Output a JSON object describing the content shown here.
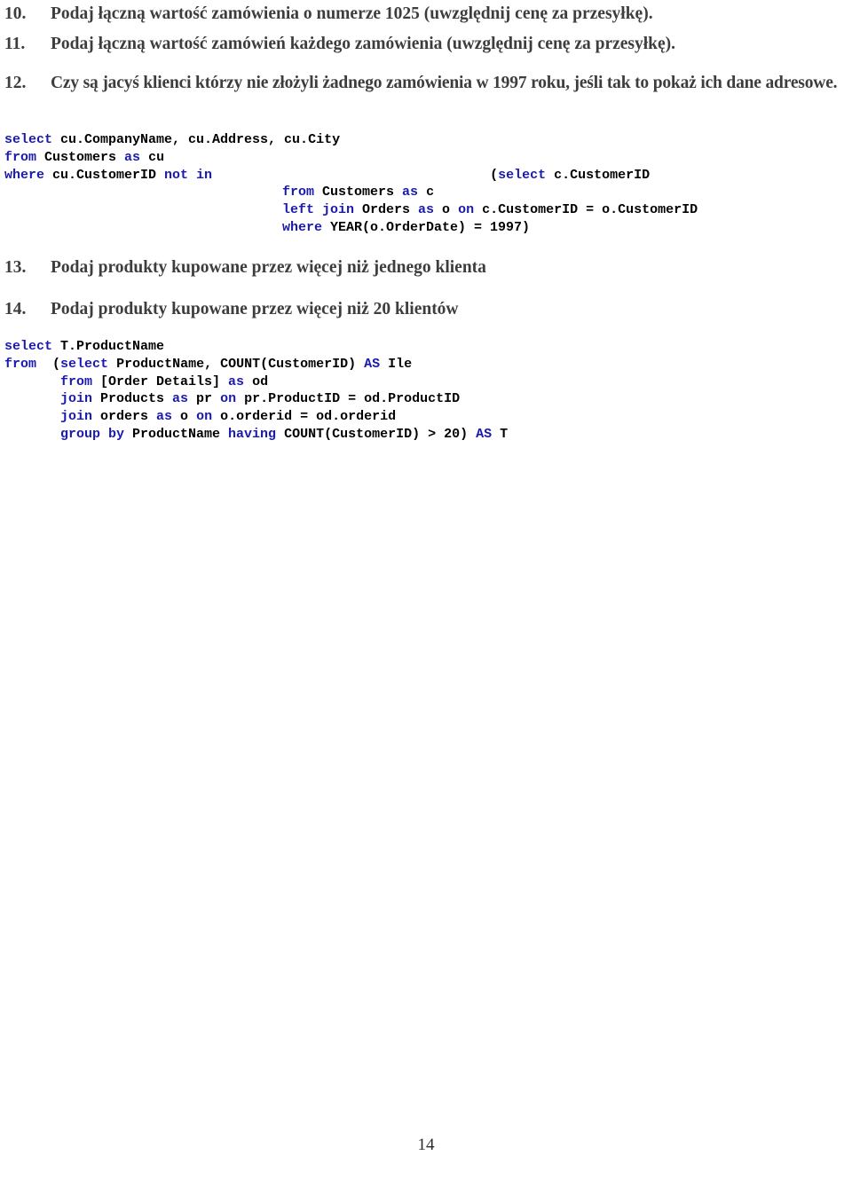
{
  "document": {
    "page_number": "14",
    "language": "pl",
    "colors": {
      "heading_text": "#3d3d3d",
      "code_keyword": "#1a1aae",
      "code_identifier": "#000000",
      "background": "#ffffff"
    }
  },
  "items": [
    {
      "number": "10.",
      "text": "Podaj łączną wartość zamówienia o numerze 1025 (uwzględnij cenę za przesyłkę)."
    },
    {
      "number": "11.",
      "text": "Podaj łączną wartość zamówień każdego zamówienia (uwzględnij cenę za przesyłkę)."
    },
    {
      "number": "12.",
      "text": "Czy są jacyś klienci którzy nie złożyli żadnego zamówienia w 1997 roku, jeśli tak to pokaż ich dane adresowe."
    },
    {
      "number": "13.",
      "text": "Podaj produkty kupowane przez więcej niż jednego klienta"
    },
    {
      "number": "14.",
      "text": "Podaj produkty kupowane przez więcej niż 20 klientów"
    }
  ],
  "code_blocks": [
    {
      "id": "query-12",
      "lines": [
        [
          {
            "t": "select",
            "c": "kw"
          },
          {
            "t": " cu.CompanyName, cu.Address, cu.City",
            "c": "ident"
          }
        ],
        [
          {
            "t": "from",
            "c": "kw"
          },
          {
            "t": " Customers ",
            "c": "ident"
          },
          {
            "t": "as",
            "c": "kw"
          },
          {
            "t": " cu",
            "c": "ident"
          }
        ],
        [
          {
            "t": "where",
            "c": "kw"
          },
          {
            "t": " cu.CustomerID ",
            "c": "ident"
          },
          {
            "t": "not in",
            "c": "kw"
          },
          {
            "t": "",
            "c": "indent-sub1"
          },
          {
            "t": "(",
            "c": "ident"
          },
          {
            "t": "select",
            "c": "kw"
          },
          {
            "t": " c.CustomerID",
            "c": "ident"
          }
        ],
        [
          {
            "t": "",
            "c": "indent-sub1"
          },
          {
            "t": "from",
            "c": "kw"
          },
          {
            "t": " Customers ",
            "c": "ident"
          },
          {
            "t": "as",
            "c": "kw"
          },
          {
            "t": " c",
            "c": "ident"
          }
        ],
        [
          {
            "t": "",
            "c": "indent-sub1"
          },
          {
            "t": "left join",
            "c": "kw"
          },
          {
            "t": " Orders ",
            "c": "ident"
          },
          {
            "t": "as",
            "c": "kw"
          },
          {
            "t": " o ",
            "c": "ident"
          },
          {
            "t": "on",
            "c": "kw"
          },
          {
            "t": " c.CustomerID = o.CustomerID",
            "c": "ident"
          }
        ],
        [
          {
            "t": "",
            "c": "indent-sub1"
          },
          {
            "t": "where",
            "c": "kw"
          },
          {
            "t": " YEAR(o.OrderDate) = 1997)",
            "c": "ident"
          }
        ]
      ]
    },
    {
      "id": "query-14",
      "lines": [
        [
          {
            "t": "select",
            "c": "kw"
          },
          {
            "t": " T.ProductName",
            "c": "ident"
          }
        ],
        [
          {
            "t": "from",
            "c": "kw"
          },
          {
            "t": "  ",
            "c": "ident"
          },
          {
            "t": "(",
            "c": "ident"
          },
          {
            "t": "select",
            "c": "kw"
          },
          {
            "t": " ProductName, COUNT(CustomerID) ",
            "c": "ident"
          },
          {
            "t": "AS",
            "c": "kw"
          },
          {
            "t": " Ile",
            "c": "ident"
          }
        ],
        [
          {
            "t": "",
            "c": "indent-sub2"
          },
          {
            "t": "from",
            "c": "kw"
          },
          {
            "t": " [Order Details] ",
            "c": "ident"
          },
          {
            "t": "as",
            "c": "kw"
          },
          {
            "t": " od",
            "c": "ident"
          }
        ],
        [
          {
            "t": "",
            "c": "indent-sub2"
          },
          {
            "t": "join",
            "c": "kw"
          },
          {
            "t": " Products ",
            "c": "ident"
          },
          {
            "t": "as",
            "c": "kw"
          },
          {
            "t": " pr ",
            "c": "ident"
          },
          {
            "t": "on",
            "c": "kw"
          },
          {
            "t": " pr.ProductID = od.ProductID",
            "c": "ident"
          }
        ],
        [
          {
            "t": "",
            "c": "indent-sub2"
          },
          {
            "t": "join",
            "c": "kw"
          },
          {
            "t": " orders ",
            "c": "ident"
          },
          {
            "t": "as",
            "c": "kw"
          },
          {
            "t": " o ",
            "c": "ident"
          },
          {
            "t": "on",
            "c": "kw"
          },
          {
            "t": " o.orderid = od.orderid",
            "c": "ident"
          }
        ],
        [
          {
            "t": "",
            "c": "indent-sub2"
          },
          {
            "t": "group by",
            "c": "kw"
          },
          {
            "t": " ProductName ",
            "c": "ident"
          },
          {
            "t": "having",
            "c": "kw"
          },
          {
            "t": " COUNT(CustomerID) > 20) ",
            "c": "ident"
          },
          {
            "t": "AS",
            "c": "kw"
          },
          {
            "t": " T",
            "c": "ident"
          }
        ]
      ]
    }
  ]
}
